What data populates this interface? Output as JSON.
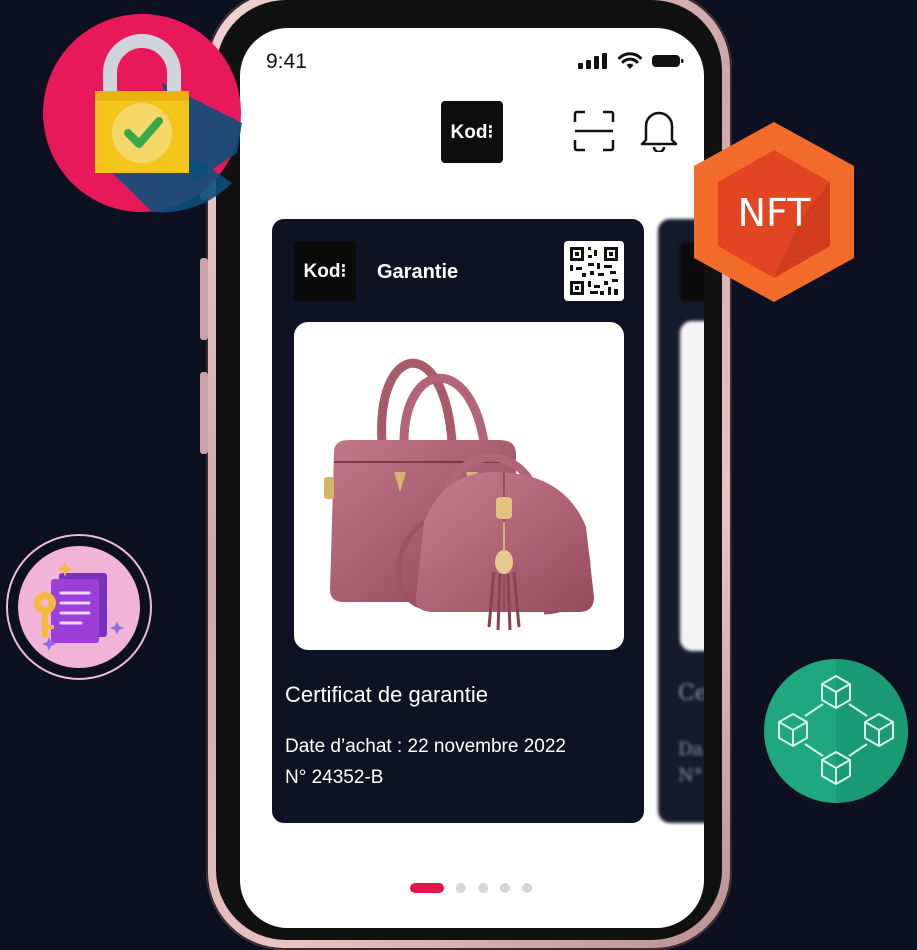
{
  "status_bar": {
    "time": "9:41"
  },
  "header": {
    "logo_text": "Kod⁝",
    "scan_icon": "scan-icon",
    "bell_icon": "bell-icon"
  },
  "card": {
    "logo_text": "Kod⁝",
    "label": "Garantie",
    "title": "Certificat de garantie",
    "purchase_date": "Date d’achat : 22 novembre 2022",
    "number": "N° 24352-B"
  },
  "ghost_card": {
    "partial_title": "Ce",
    "partial_line1": "Da",
    "partial_line2": "N°"
  },
  "badges": {
    "nft_text": "NFT"
  },
  "pagination": {
    "count": 5,
    "active_index": 0
  },
  "colors": {
    "accent": "#e1154c",
    "background": "#0d1020",
    "card": "#0f1222",
    "nft": "#f05a24",
    "blockchain": "#1fa77f"
  }
}
